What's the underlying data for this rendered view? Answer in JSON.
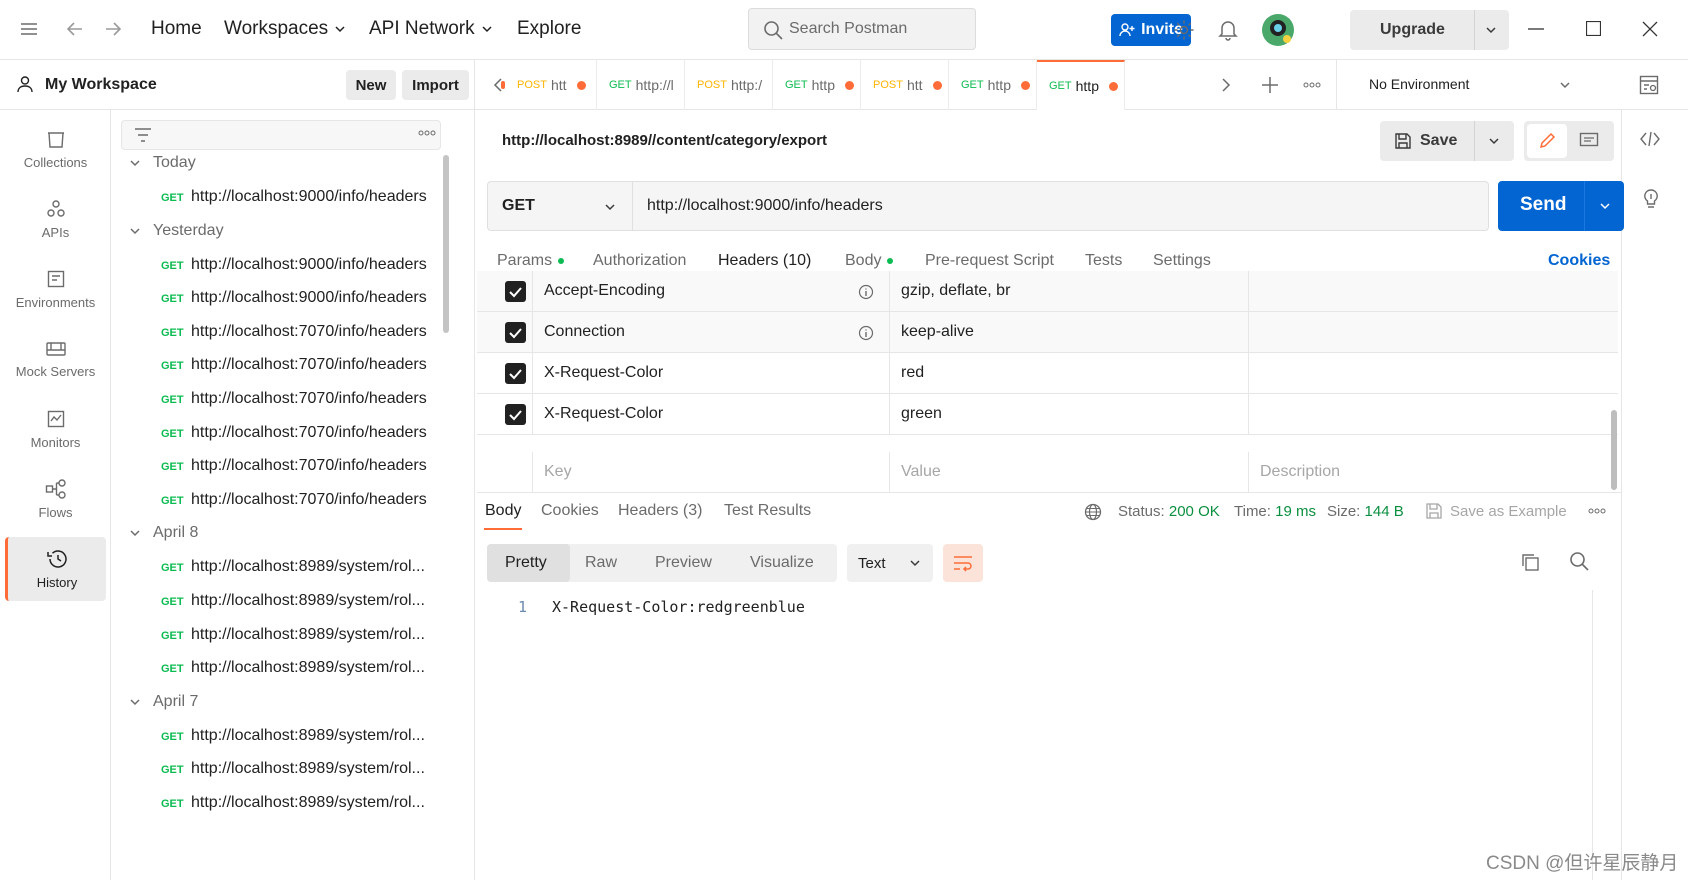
{
  "topbar": {
    "nav": [
      "Home",
      "Workspaces",
      "API Network",
      "Explore"
    ],
    "search_placeholder": "Search Postman",
    "invite_label": "Invite",
    "upgrade_label": "Upgrade"
  },
  "workspace": {
    "name": "My Workspace",
    "new_label": "New",
    "import_label": "Import"
  },
  "rail": [
    {
      "label": "Collections",
      "icon": "collections-icon"
    },
    {
      "label": "APIs",
      "icon": "apis-icon"
    },
    {
      "label": "Environments",
      "icon": "environments-icon"
    },
    {
      "label": "Mock Servers",
      "icon": "mock-servers-icon"
    },
    {
      "label": "Monitors",
      "icon": "monitors-icon"
    },
    {
      "label": "Flows",
      "icon": "flows-icon"
    },
    {
      "label": "History",
      "icon": "history-icon",
      "active": true
    }
  ],
  "history": {
    "groups": [
      {
        "label": "Today",
        "items": [
          {
            "method": "GET",
            "url": "http://localhost:9000/info/headers"
          }
        ]
      },
      {
        "label": "Yesterday",
        "items": [
          {
            "method": "GET",
            "url": "http://localhost:9000/info/headers"
          },
          {
            "method": "GET",
            "url": "http://localhost:9000/info/headers"
          },
          {
            "method": "GET",
            "url": "http://localhost:7070/info/headers"
          },
          {
            "method": "GET",
            "url": "http://localhost:7070/info/headers"
          },
          {
            "method": "GET",
            "url": "http://localhost:7070/info/headers"
          },
          {
            "method": "GET",
            "url": "http://localhost:7070/info/headers"
          },
          {
            "method": "GET",
            "url": "http://localhost:7070/info/headers"
          },
          {
            "method": "GET",
            "url": "http://localhost:7070/info/headers"
          }
        ]
      },
      {
        "label": "April 8",
        "items": [
          {
            "method": "GET",
            "url": "http://localhost:8989/system/rol..."
          },
          {
            "method": "GET",
            "url": "http://localhost:8989/system/rol..."
          },
          {
            "method": "GET",
            "url": "http://localhost:8989/system/rol..."
          },
          {
            "method": "GET",
            "url": "http://localhost:8989/system/rol..."
          }
        ]
      },
      {
        "label": "April 7",
        "items": [
          {
            "method": "GET",
            "url": "http://localhost:8989/system/rol..."
          },
          {
            "method": "GET",
            "url": "http://localhost:8989/system/rol..."
          },
          {
            "method": "GET",
            "url": "http://localhost:8989/system/rol..."
          }
        ]
      }
    ]
  },
  "tabs": [
    {
      "method": "POST",
      "label": "htt"
    },
    {
      "method": "GET",
      "label": "http://l"
    },
    {
      "method": "POST",
      "label": "http:/"
    },
    {
      "method": "GET",
      "label": "http"
    },
    {
      "method": "POST",
      "label": "htt"
    },
    {
      "method": "GET",
      "label": "http"
    },
    {
      "method": "GET",
      "label": "http",
      "active": true
    }
  ],
  "environment": "No Environment",
  "request": {
    "title": "http://localhost:8989//content/category/export",
    "save_label": "Save",
    "method": "GET",
    "url": "http://localhost:9000/info/headers",
    "send_label": "Send",
    "tabs": [
      "Params",
      "Authorization",
      "Headers (10)",
      "Body",
      "Pre-request Script",
      "Tests",
      "Settings"
    ],
    "cookies_label": "Cookies"
  },
  "headers": [
    {
      "key": "Accept-Encoding",
      "value": "gzip, deflate, br"
    },
    {
      "key": "Connection",
      "value": "keep-alive"
    },
    {
      "key": "X-Request-Color",
      "value": "red"
    },
    {
      "key": "X-Request-Color",
      "value": "green"
    }
  ],
  "headers_placeholder": {
    "key": "Key",
    "value": "Value",
    "description": "Description"
  },
  "response": {
    "tabs": [
      "Body",
      "Cookies",
      "Headers (3)",
      "Test Results"
    ],
    "status_label": "Status:",
    "status": "200 OK",
    "time_label": "Time:",
    "time": "19 ms",
    "size_label": "Size:",
    "size": "144 B",
    "save_example": "Save as Example",
    "views": [
      "Pretty",
      "Raw",
      "Preview",
      "Visualize"
    ],
    "format": "Text",
    "line_no": "1",
    "body": "X-Request-Color:redgreenblue"
  },
  "watermark": "CSDN @但许星辰静月",
  "colors": {
    "accent": "#ff6c37",
    "brand_blue": "#0265d2",
    "get_green": "#0cbb52",
    "post_yellow": "#ffb400"
  }
}
